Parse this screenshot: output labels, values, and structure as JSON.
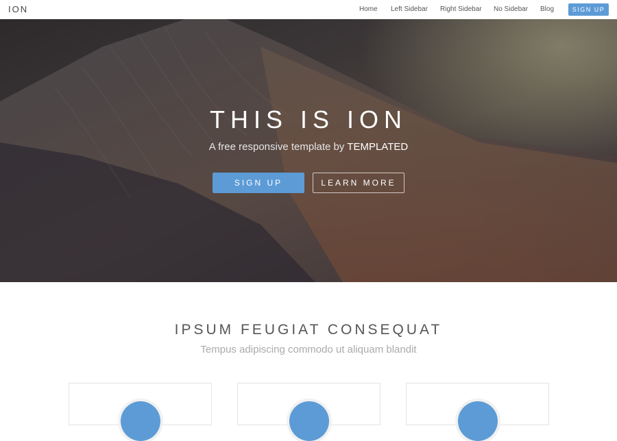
{
  "header": {
    "logo": "ION",
    "nav": [
      {
        "label": "Home"
      },
      {
        "label": "Left Sidebar"
      },
      {
        "label": "Right Sidebar"
      },
      {
        "label": "No Sidebar"
      },
      {
        "label": "Blog"
      }
    ],
    "signup_label": "SIGN UP"
  },
  "hero": {
    "title": "THIS IS ION",
    "subtitle_prefix": "A free responsive template by ",
    "subtitle_brand": "TEMPLATED",
    "primary_button": "SIGN UP",
    "secondary_button": "LEARN MORE"
  },
  "section": {
    "title": "IPSUM FEUGIAT CONSEQUAT",
    "subtitle": "Tempus adipiscing commodo ut aliquam blandit"
  },
  "cards": [
    {
      "icon": "feature-icon"
    },
    {
      "icon": "feature-icon"
    },
    {
      "icon": "feature-icon"
    }
  ],
  "colors": {
    "accent": "#5d9bd6",
    "header_bg": "#ffffff",
    "text": "#555555",
    "muted_text": "#aaaaaa"
  }
}
